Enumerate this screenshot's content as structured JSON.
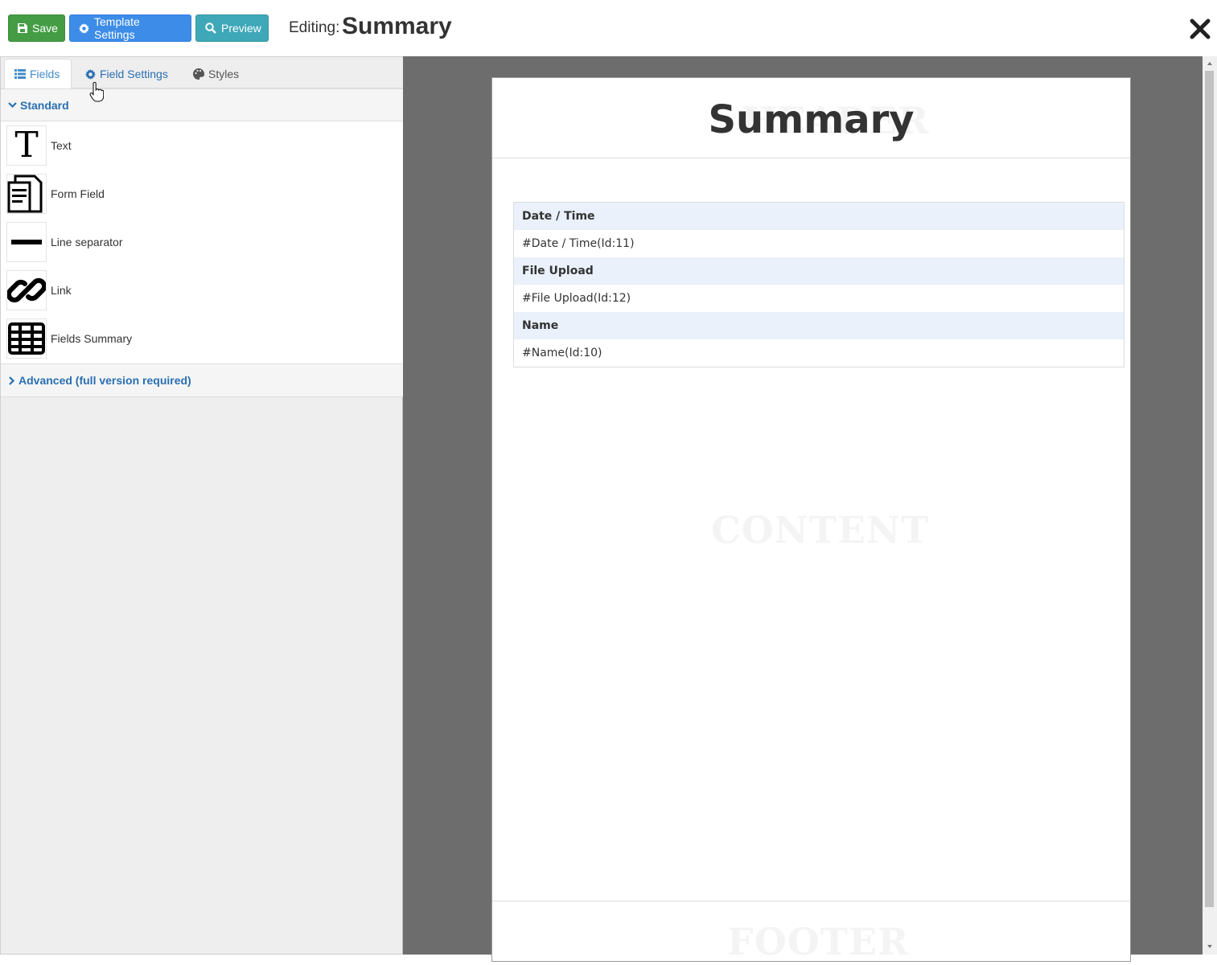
{
  "toolbar": {
    "save_label": "Save",
    "template_settings_label": "Template Settings",
    "preview_label": "Preview",
    "editing_label": "Editing:",
    "editing_title": "Summary"
  },
  "colors": {
    "save": "#449d44",
    "template_settings": "#3c8ce8",
    "preview": "#3fa8b8",
    "link": "#2a6fb1",
    "canvas_bg": "#6d6d6d",
    "table_label_bg": "#eaf1fa"
  },
  "left_panel": {
    "tabs": [
      {
        "label": "Fields",
        "icon": "list-icon",
        "active": true
      },
      {
        "label": "Field Settings",
        "icon": "gear-icon",
        "active": false
      },
      {
        "label": "Styles",
        "icon": "palette-icon",
        "active": false
      }
    ],
    "standard_section": {
      "label": "Standard",
      "expanded": true,
      "items": [
        {
          "label": "Text",
          "icon": "text-T-icon"
        },
        {
          "label": "Form Field",
          "icon": "form-field-icon"
        },
        {
          "label": "Line separator",
          "icon": "line-separator-icon"
        },
        {
          "label": "Link",
          "icon": "link-chain-icon"
        },
        {
          "label": "Fields Summary",
          "icon": "table-grid-icon"
        }
      ]
    },
    "advanced_section": {
      "label": "Advanced (full version required)",
      "expanded": false
    }
  },
  "page": {
    "title": "Summary",
    "watermarks": {
      "header": "HEADER",
      "content": "CONTENT",
      "footer": "FOOTER"
    },
    "summary_rows": [
      {
        "label": "Date / Time",
        "value": "#Date / Time(Id:11)"
      },
      {
        "label": "File Upload",
        "value": "#File Upload(Id:12)"
      },
      {
        "label": "Name",
        "value": "#Name(Id:10)"
      }
    ]
  }
}
